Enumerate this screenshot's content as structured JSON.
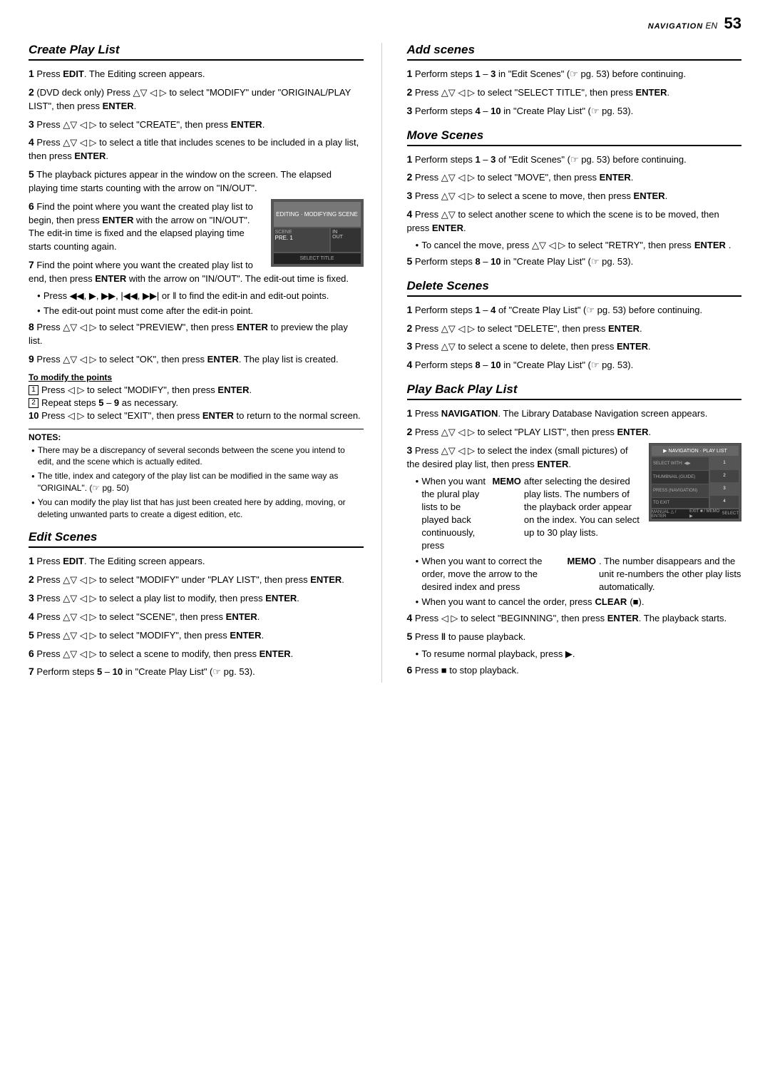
{
  "header": {
    "nav_label": "NAVIGATION",
    "lang": "EN",
    "page_num": "53"
  },
  "create_play_list": {
    "title": "Create Play List",
    "steps": [
      {
        "num": "1",
        "text": "Press EDIT. The Editing screen appears."
      },
      {
        "num": "2",
        "text": "(DVD deck only) Press △▽ ◁ ▷ to select \"MODIFY\" under \"ORIGINAL/PLAY LIST\", then press ENTER."
      },
      {
        "num": "3",
        "text": "Press △▽ ◁ ▷ to select \"CREATE\", then press ENTER."
      },
      {
        "num": "4",
        "text": "Press △▽ ◁ ▷ to select a title that includes scenes to be included in a play list, then press ENTER."
      },
      {
        "num": "5",
        "text": "The playback pictures appear in the window on the screen. The elapsed playing time starts counting with the arrow on \"IN/OUT\"."
      },
      {
        "num": "6",
        "text": "Find the point where you want the created play list to begin, then press ENTER with the arrow on \"IN/OUT\". The edit-in time is fixed and the elapsed playing time starts counting again."
      },
      {
        "num": "7",
        "text": "Find the point where you want the created play list to end, then press ENTER with the arrow on \"IN/OUT\". The edit-out time is fixed."
      },
      {
        "num": "bullet1",
        "text": "Press ◀◀, ▶, ▶▶, |◀◀, ▶▶| or ‖ to find the edit-in and edit-out points."
      },
      {
        "num": "bullet2",
        "text": "The edit-out point must come after the edit-in point."
      },
      {
        "num": "8",
        "text": "Press △▽ ◁ ▷ to select \"PREVIEW\", then press ENTER to preview the play list."
      },
      {
        "num": "9",
        "text": "Press △▽ ◁ ▷ to select \"OK\", then press ENTER. The play list is created."
      }
    ],
    "to_modify_heading": "To modify the points",
    "to_modify_steps": [
      {
        "num": "1",
        "text": "Press ◁ ▷ to select \"MODIFY\", then press ENTER."
      },
      {
        "num": "2",
        "text": "Repeat steps 5 – 9 as necessary."
      }
    ],
    "step10": "Press ◁ ▷ to select \"EXIT\", then press ENTER to return to the normal screen.",
    "notes_heading": "NOTES:",
    "notes": [
      "There may be a discrepancy of several seconds between the scene you intend to edit, and the scene which is actually edited.",
      "The title, index and category of the play list can be modified in the same way as \"ORIGINAL\". (☞ pg. 50)",
      "You can modify the play list that has just been created here by adding, moving, or deleting unwanted parts to create a digest edition, etc."
    ]
  },
  "edit_scenes": {
    "title": "Edit Scenes",
    "steps": [
      {
        "num": "1",
        "text": "Press EDIT. The Editing screen appears."
      },
      {
        "num": "2",
        "text": "Press △▽ ◁ ▷ to select \"MODIFY\" under \"PLAY LIST\", then press ENTER."
      },
      {
        "num": "3",
        "text": "Press △▽ ◁ ▷ to select a play list to modify, then press ENTER."
      },
      {
        "num": "4",
        "text": "Press △▽ ◁ ▷ to select \"SCENE\", then press ENTER."
      },
      {
        "num": "5",
        "text": "Press △▽ ◁ ▷ to select \"MODIFY\", then press ENTER."
      },
      {
        "num": "6",
        "text": "Press △▽ ◁ ▷ to select a scene to modify, then press ENTER."
      },
      {
        "num": "7",
        "text": "Perform steps 5 – 10 in \"Create Play List\" (☞ pg. 53)."
      }
    ]
  },
  "add_scenes": {
    "title": "Add scenes",
    "steps": [
      {
        "num": "1",
        "text": "Perform steps 1 – 3 in \"Edit Scenes\" (☞ pg. 53) before continuing."
      },
      {
        "num": "2",
        "text": "Press △▽ ◁ ▷ to select \"SELECT TITLE\", then press ENTER."
      },
      {
        "num": "3",
        "text": "Perform steps 4 – 10 in \"Create Play List\" (☞ pg. 53)."
      }
    ]
  },
  "move_scenes": {
    "title": "Move Scenes",
    "steps": [
      {
        "num": "1",
        "text": "Perform steps 1 – 3 of \"Edit Scenes\" (☞ pg. 53) before continuing."
      },
      {
        "num": "2",
        "text": "Press △▽ ◁ ▷ to select \"MOVE\", then press ENTER."
      },
      {
        "num": "3",
        "text": "Press △▽ ◁ ▷ to select a scene to move, then press ENTER."
      },
      {
        "num": "4",
        "text": "Press △▽ to select another scene to which the scene is to be moved, then press ENTER."
      },
      {
        "num": "bullet1",
        "text": "To cancel the move, press △▽ ◁ ▷ to select \"RETRY\", then press ENTER."
      },
      {
        "num": "5",
        "text": "Perform steps 8 – 10 in \"Create Play List\" (☞ pg. 53)."
      }
    ]
  },
  "delete_scenes": {
    "title": "Delete Scenes",
    "steps": [
      {
        "num": "1",
        "text": "Perform steps 1 – 4 of \"Create Play List\" (☞ pg. 53) before continuing."
      },
      {
        "num": "2",
        "text": "Press △▽ ◁ ▷ to select \"DELETE\", then press ENTER."
      },
      {
        "num": "3",
        "text": "Press △▽ to select a scene to delete, then press ENTER."
      },
      {
        "num": "4",
        "text": "Perform steps 8 – 10 in \"Create Play List\" (☞ pg. 53)."
      }
    ]
  },
  "play_back_play_list": {
    "title": "Play Back Play List",
    "steps": [
      {
        "num": "1",
        "text": "Press NAVIGATION. The Library Database Navigation screen appears."
      },
      {
        "num": "2",
        "text": "Press △▽ ◁ ▷ to select \"PLAY LIST\", then press ENTER."
      },
      {
        "num": "3",
        "text": "Press △▽ ◁ ▷ to select the index (small pictures) of the desired play list, then press ENTER."
      },
      {
        "num": "bullet1",
        "text": "When you want the plural play lists to be played back continuously, press MEMO after selecting the desired play lists. The numbers of the playback order appear on the index. You can select up to 30 play lists."
      },
      {
        "num": "bullet2",
        "text": "When you want to correct the order, move the arrow to the desired index and press MEMO. The number disappears and the unit re-numbers the other play lists automatically."
      },
      {
        "num": "bullet3",
        "text": "When you want to cancel the order, press CLEAR (■)."
      },
      {
        "num": "4",
        "text": "Press ◁ ▷ to select \"BEGINNING\", then press ENTER. The playback starts."
      },
      {
        "num": "5",
        "text": "Press ‖ to pause playback."
      },
      {
        "num": "bullet4",
        "text": "To resume normal playback, press ▶."
      },
      {
        "num": "6",
        "text": "Press ■ to stop playback."
      }
    ]
  }
}
